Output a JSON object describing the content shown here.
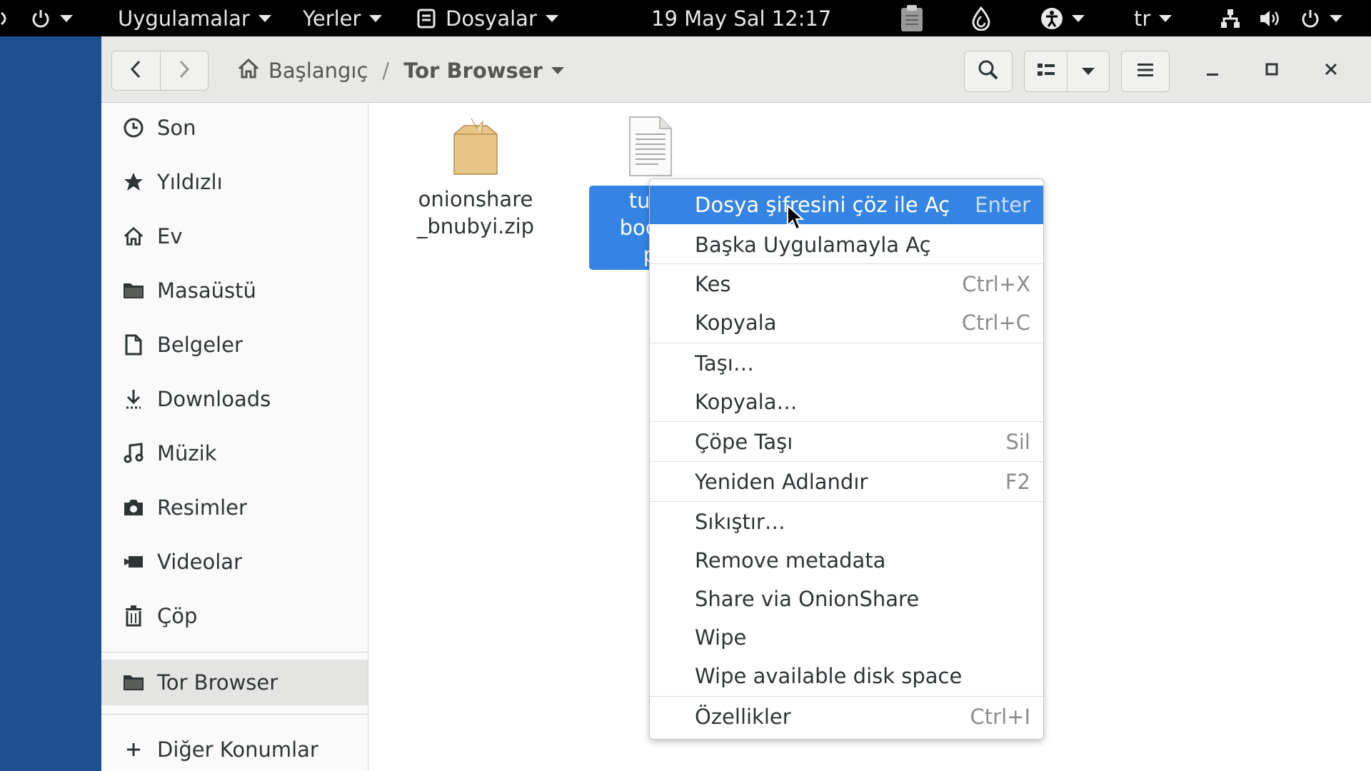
{
  "topbar": {
    "applications": "Uygulamalar",
    "places": "Yerler",
    "app_name": "Dosyalar",
    "datetime": "19 May Sal  12:17",
    "language": "tr",
    "icons": [
      "power-icon",
      "clipboard-icon",
      "onion-icon",
      "accessibility-icon",
      "network-icon",
      "volume-icon",
      "power-icon"
    ]
  },
  "header": {
    "home_crumb": "Başlangıç",
    "separator": "/",
    "current_crumb": "Tor Browser"
  },
  "sidebar": {
    "items": [
      {
        "label": "Son",
        "icon": "clock-icon"
      },
      {
        "label": "Yıldızlı",
        "icon": "star-icon"
      },
      {
        "label": "Ev",
        "icon": "home-icon"
      },
      {
        "label": "Masaüstü",
        "icon": "folder-icon"
      },
      {
        "label": "Belgeler",
        "icon": "document-icon"
      },
      {
        "label": "Downloads",
        "icon": "download-icon"
      },
      {
        "label": "Müzik",
        "icon": "music-icon"
      },
      {
        "label": "Resimler",
        "icon": "camera-icon"
      },
      {
        "label": "Videolar",
        "icon": "video-icon"
      },
      {
        "label": "Çöp",
        "icon": "trash-icon"
      }
    ],
    "bookmark": {
      "label": "Tor Browser",
      "icon": "folder-icon"
    },
    "other_locations": {
      "label": "Diğer Konumlar",
      "icon": "plus-icon"
    }
  },
  "files": [
    {
      "line1": "onionshare",
      "line2": "_bnubyi.zip",
      "icon": "archive-icon"
    },
    {
      "line1": "turk",
      "line2": "bodru",
      "line3": "p",
      "icon": "text-file-icon",
      "selected": true
    }
  ],
  "context_menu": {
    "items": [
      {
        "label": "Dosya şifresini çöz ile Aç",
        "accel": "Enter"
      },
      {
        "label": "Başka Uygulamayla Aç",
        "accel": ""
      },
      {
        "label": "Kes",
        "accel": "Ctrl+X"
      },
      {
        "label": "Kopyala",
        "accel": "Ctrl+C"
      },
      {
        "label": "Taşı…",
        "accel": ""
      },
      {
        "label": "Kopyala…",
        "accel": ""
      },
      {
        "label": "Çöpe Taşı",
        "accel": "Sil"
      },
      {
        "label": "Yeniden Adlandır",
        "accel": "F2"
      },
      {
        "label": "Sıkıştır…",
        "accel": ""
      },
      {
        "label": "Remove metadata",
        "accel": ""
      },
      {
        "label": "Share via OnionShare",
        "accel": ""
      },
      {
        "label": "Wipe",
        "accel": ""
      },
      {
        "label": "Wipe available disk space",
        "accel": ""
      },
      {
        "label": "Özellikler",
        "accel": "Ctrl+I"
      }
    ]
  },
  "colors": {
    "accent": "#3584e4",
    "desktop": "#1d4f91",
    "topbar": "#000000"
  }
}
